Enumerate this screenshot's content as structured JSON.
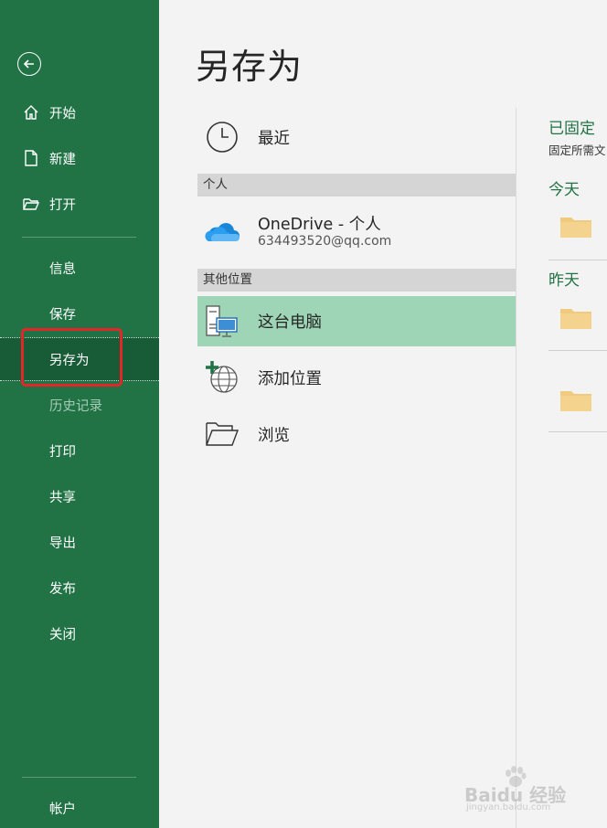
{
  "sidebar": {
    "items": [
      {
        "label": "开始"
      },
      {
        "label": "新建"
      },
      {
        "label": "打开"
      },
      {
        "label": "信息"
      },
      {
        "label": "保存"
      },
      {
        "label": "另存为"
      },
      {
        "label": "历史记录"
      },
      {
        "label": "打印"
      },
      {
        "label": "共享"
      },
      {
        "label": "导出"
      },
      {
        "label": "发布"
      },
      {
        "label": "关闭"
      },
      {
        "label": "帐户"
      }
    ]
  },
  "main": {
    "title": "另存为",
    "recent_label": "最近",
    "section_personal": "个人",
    "onedrive_name": "OneDrive - 个人",
    "onedrive_email": "634493520@qq.com",
    "section_other": "其他位置",
    "this_pc": "这台电脑",
    "add_place": "添加位置",
    "browse": "浏览"
  },
  "right_panel": {
    "pinned_title": "已固定",
    "pinned_sub": "固定所需文",
    "today": "今天",
    "yesterday": "昨天"
  },
  "watermark": {
    "text": "Baidu 经验",
    "sub": "jingyan.baidu.com"
  },
  "colors": {
    "accent": "#217346",
    "selected": "#9fd5b7",
    "highlight": "#e3262a"
  }
}
